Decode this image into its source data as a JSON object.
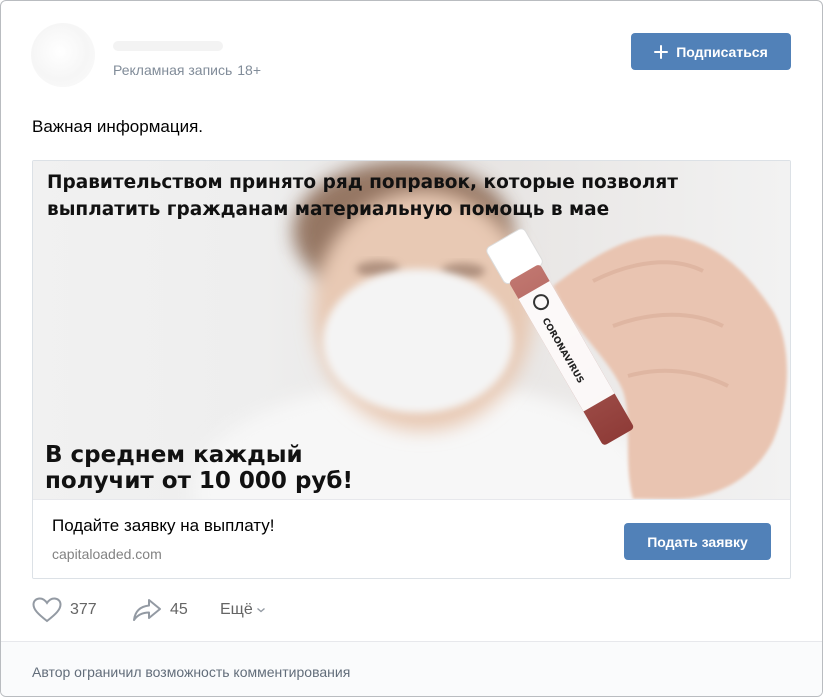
{
  "header": {
    "ad_label": "Рекламная запись",
    "age_rating": "18+",
    "subscribe_label": "Подписаться",
    "subscribe_icon": "plus-icon"
  },
  "post": {
    "text": "Важная информация."
  },
  "ad": {
    "image_headline": "Правительством принято ряд поправок, которые позволят выплатить гражданам материальную помощь в мае",
    "image_bottom_text": "В среднем каждый получит от 10 000 руб!",
    "tube_label": "CORONAVIRUS",
    "cta_title": "Подайте заявку на выплату!",
    "domain": "capitaloaded.com",
    "button_label": "Подать заявку"
  },
  "actions": {
    "likes": "377",
    "shares": "45",
    "more_label": "Ещё",
    "like_icon": "heart-icon",
    "share_icon": "share-arrow-icon",
    "more_icon": "chevron-down-icon"
  },
  "footer": {
    "comments_notice": "Автор ограничил возможность комментирования"
  },
  "colors": {
    "accent": "#5181b8",
    "muted_text": "#818c99",
    "footer_bg": "#fafbfc"
  }
}
